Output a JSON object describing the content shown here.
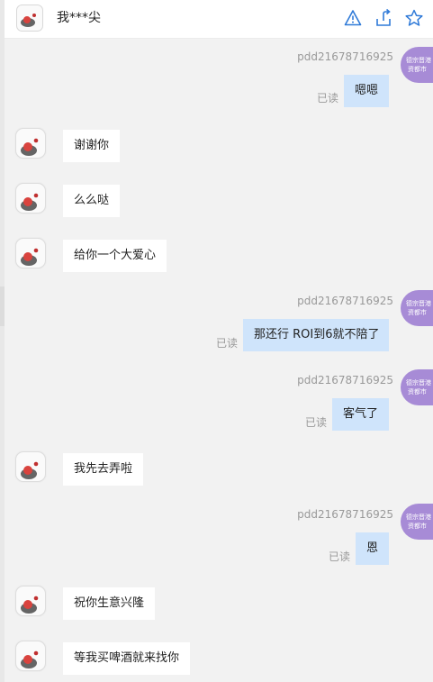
{
  "header": {
    "title": "我***尖",
    "icons": [
      "warning-icon",
      "share-icon",
      "star-icon"
    ]
  },
  "self": {
    "name": "pdd21678716925",
    "avatar_line1": "德宗晋港",
    "avatar_line2": "资都市",
    "read_label": "已读"
  },
  "messages": [
    {
      "direction": "out",
      "text": "嗯嗯"
    },
    {
      "direction": "in",
      "text": "谢谢你"
    },
    {
      "direction": "in",
      "text": "么么哒"
    },
    {
      "direction": "in",
      "text": "给你一个大爱心"
    },
    {
      "direction": "out",
      "text": "那还行 ROI到6就不陪了"
    },
    {
      "direction": "out",
      "text": "客气了"
    },
    {
      "direction": "in",
      "text": "我先去弄啦"
    },
    {
      "direction": "out",
      "text": "恩"
    },
    {
      "direction": "in",
      "text": "祝你生意兴隆"
    },
    {
      "direction": "in",
      "text": "等我买啤酒就来找你"
    }
  ],
  "colors": {
    "background": "#f2f2f2",
    "out_bubble": "#cfe4fb",
    "in_bubble": "#ffffff",
    "icon_blue": "#2f7ad8",
    "self_avatar": "#a78bd6"
  }
}
